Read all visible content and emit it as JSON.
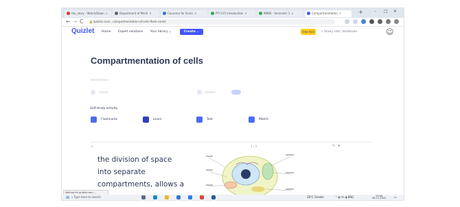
{
  "browser": {
    "tabs": [
      {
        "label": "the_story - Watch/Down",
        "color": "#d8382b"
      },
      {
        "label": "Department of Mech",
        "color": "#5f6368"
      },
      {
        "label": "Coursera for Scien",
        "color": "#3a6fd8"
      },
      {
        "label": "PTI 515 Introduction",
        "color": "#34a853"
      },
      {
        "label": "MBBS - Semester 1",
        "color": "#34a853"
      },
      {
        "label": "Compartmentation",
        "color": "#4255ff"
      }
    ],
    "new_tab": "+",
    "window_controls": {
      "minimize": "–",
      "maximize": "□",
      "close": "✕"
    },
    "nav": {
      "back": "←",
      "forward": "→",
      "reload": "C"
    },
    "url": "quizlet.com/...compartmentation-of-cells-flash-cards/"
  },
  "quizlet": {
    "logo": "Quizlet",
    "nav": {
      "home": "Home",
      "expert": "Expert solutions",
      "library": "Your library"
    },
    "create_label": "Create",
    "free_trial_label": "Free trial",
    "search_placeholder": "Study sets, textbooks"
  },
  "set": {
    "title": "Compartmentation of cells",
    "self_study_label": "Self-study activity",
    "modes": [
      {
        "label": "Flashcards",
        "color": "#4a6cf0"
      },
      {
        "label": "Learn",
        "color": "#2f3fbf"
      },
      {
        "label": "Test",
        "color": "#4a6cf0"
      },
      {
        "label": "Match",
        "color": "#4a6cf0"
      }
    ]
  },
  "flashcard": {
    "counter": "1 / 3",
    "text_lines": [
      "the division of space",
      "into separate",
      "compartments, allows a"
    ]
  },
  "status_bar": {
    "text": "Waiting for quizlet.com..."
  },
  "taskbar": {
    "start_icon": "windows-icon",
    "search_placeholder": "Type here to search",
    "apps": [
      {
        "name": "task-view-icon",
        "color": "#5a6b84"
      },
      {
        "name": "edge-icon",
        "color": "#1a86d0"
      },
      {
        "name": "explorer-icon",
        "color": "#f0b429"
      },
      {
        "name": "store-icon",
        "color": "#3178c6"
      },
      {
        "name": "mail-icon",
        "color": "#2d7be5"
      },
      {
        "name": "chrome-icon",
        "color": "#db4437"
      },
      {
        "name": "word-icon",
        "color": "#2b579a"
      }
    ],
    "weather": "28°C  Smoke",
    "time": "13:09",
    "date": "06-11-2022"
  }
}
